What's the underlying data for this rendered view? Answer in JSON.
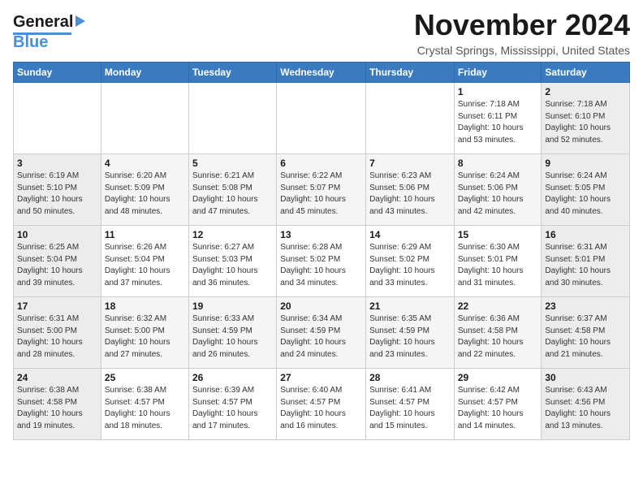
{
  "logo": {
    "line1": "General",
    "line2": "Blue"
  },
  "header": {
    "month": "November 2024",
    "location": "Crystal Springs, Mississippi, United States"
  },
  "weekdays": [
    "Sunday",
    "Monday",
    "Tuesday",
    "Wednesday",
    "Thursday",
    "Friday",
    "Saturday"
  ],
  "weeks": [
    [
      {
        "day": "",
        "info": ""
      },
      {
        "day": "",
        "info": ""
      },
      {
        "day": "",
        "info": ""
      },
      {
        "day": "",
        "info": ""
      },
      {
        "day": "",
        "info": ""
      },
      {
        "day": "1",
        "info": "Sunrise: 7:18 AM\nSunset: 6:11 PM\nDaylight: 10 hours\nand 53 minutes."
      },
      {
        "day": "2",
        "info": "Sunrise: 7:18 AM\nSunset: 6:10 PM\nDaylight: 10 hours\nand 52 minutes."
      }
    ],
    [
      {
        "day": "3",
        "info": "Sunrise: 6:19 AM\nSunset: 5:10 PM\nDaylight: 10 hours\nand 50 minutes."
      },
      {
        "day": "4",
        "info": "Sunrise: 6:20 AM\nSunset: 5:09 PM\nDaylight: 10 hours\nand 48 minutes."
      },
      {
        "day": "5",
        "info": "Sunrise: 6:21 AM\nSunset: 5:08 PM\nDaylight: 10 hours\nand 47 minutes."
      },
      {
        "day": "6",
        "info": "Sunrise: 6:22 AM\nSunset: 5:07 PM\nDaylight: 10 hours\nand 45 minutes."
      },
      {
        "day": "7",
        "info": "Sunrise: 6:23 AM\nSunset: 5:06 PM\nDaylight: 10 hours\nand 43 minutes."
      },
      {
        "day": "8",
        "info": "Sunrise: 6:24 AM\nSunset: 5:06 PM\nDaylight: 10 hours\nand 42 minutes."
      },
      {
        "day": "9",
        "info": "Sunrise: 6:24 AM\nSunset: 5:05 PM\nDaylight: 10 hours\nand 40 minutes."
      }
    ],
    [
      {
        "day": "10",
        "info": "Sunrise: 6:25 AM\nSunset: 5:04 PM\nDaylight: 10 hours\nand 39 minutes."
      },
      {
        "day": "11",
        "info": "Sunrise: 6:26 AM\nSunset: 5:04 PM\nDaylight: 10 hours\nand 37 minutes."
      },
      {
        "day": "12",
        "info": "Sunrise: 6:27 AM\nSunset: 5:03 PM\nDaylight: 10 hours\nand 36 minutes."
      },
      {
        "day": "13",
        "info": "Sunrise: 6:28 AM\nSunset: 5:02 PM\nDaylight: 10 hours\nand 34 minutes."
      },
      {
        "day": "14",
        "info": "Sunrise: 6:29 AM\nSunset: 5:02 PM\nDaylight: 10 hours\nand 33 minutes."
      },
      {
        "day": "15",
        "info": "Sunrise: 6:30 AM\nSunset: 5:01 PM\nDaylight: 10 hours\nand 31 minutes."
      },
      {
        "day": "16",
        "info": "Sunrise: 6:31 AM\nSunset: 5:01 PM\nDaylight: 10 hours\nand 30 minutes."
      }
    ],
    [
      {
        "day": "17",
        "info": "Sunrise: 6:31 AM\nSunset: 5:00 PM\nDaylight: 10 hours\nand 28 minutes."
      },
      {
        "day": "18",
        "info": "Sunrise: 6:32 AM\nSunset: 5:00 PM\nDaylight: 10 hours\nand 27 minutes."
      },
      {
        "day": "19",
        "info": "Sunrise: 6:33 AM\nSunset: 4:59 PM\nDaylight: 10 hours\nand 26 minutes."
      },
      {
        "day": "20",
        "info": "Sunrise: 6:34 AM\nSunset: 4:59 PM\nDaylight: 10 hours\nand 24 minutes."
      },
      {
        "day": "21",
        "info": "Sunrise: 6:35 AM\nSunset: 4:59 PM\nDaylight: 10 hours\nand 23 minutes."
      },
      {
        "day": "22",
        "info": "Sunrise: 6:36 AM\nSunset: 4:58 PM\nDaylight: 10 hours\nand 22 minutes."
      },
      {
        "day": "23",
        "info": "Sunrise: 6:37 AM\nSunset: 4:58 PM\nDaylight: 10 hours\nand 21 minutes."
      }
    ],
    [
      {
        "day": "24",
        "info": "Sunrise: 6:38 AM\nSunset: 4:58 PM\nDaylight: 10 hours\nand 19 minutes."
      },
      {
        "day": "25",
        "info": "Sunrise: 6:38 AM\nSunset: 4:57 PM\nDaylight: 10 hours\nand 18 minutes."
      },
      {
        "day": "26",
        "info": "Sunrise: 6:39 AM\nSunset: 4:57 PM\nDaylight: 10 hours\nand 17 minutes."
      },
      {
        "day": "27",
        "info": "Sunrise: 6:40 AM\nSunset: 4:57 PM\nDaylight: 10 hours\nand 16 minutes."
      },
      {
        "day": "28",
        "info": "Sunrise: 6:41 AM\nSunset: 4:57 PM\nDaylight: 10 hours\nand 15 minutes."
      },
      {
        "day": "29",
        "info": "Sunrise: 6:42 AM\nSunset: 4:57 PM\nDaylight: 10 hours\nand 14 minutes."
      },
      {
        "day": "30",
        "info": "Sunrise: 6:43 AM\nSunset: 4:56 PM\nDaylight: 10 hours\nand 13 minutes."
      }
    ]
  ]
}
